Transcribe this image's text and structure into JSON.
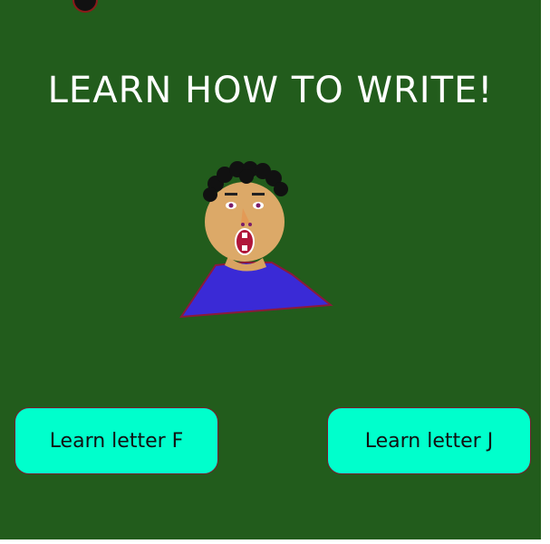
{
  "app": {
    "title": "LEARN HOW TO WRITE!"
  },
  "buttons": {
    "letter_f": "Learn letter F",
    "letter_j": "Learn letter J"
  },
  "colors": {
    "background": "#225c1c",
    "button_fill": "#00ffcc",
    "button_border": "#7a1d2e",
    "title_text": "#ffffff"
  },
  "icons": {
    "character": "cartoon-boy-avatar",
    "ball": "dark-circle"
  }
}
